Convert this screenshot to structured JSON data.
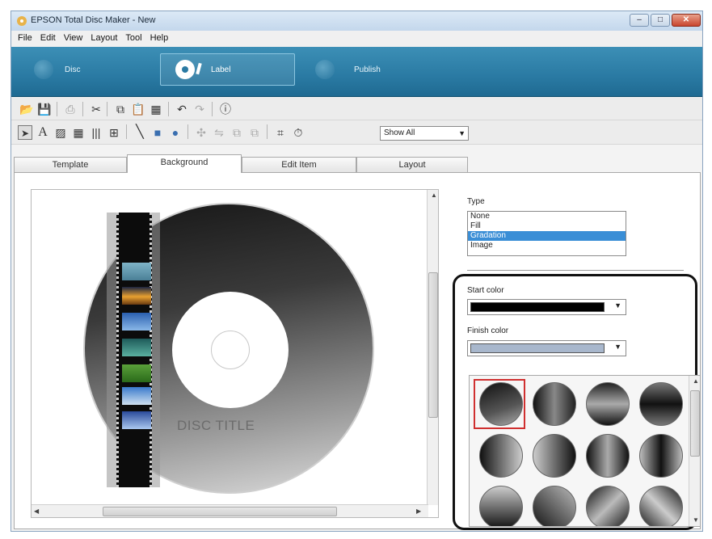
{
  "window": {
    "title": "EPSON Total Disc Maker - New"
  },
  "menu": [
    "File",
    "Edit",
    "View",
    "Layout",
    "Tool",
    "Help"
  ],
  "modes": {
    "disc": "Disc",
    "label": "Label",
    "publish": "Publish"
  },
  "toolbar": {
    "filter_value": "Show All"
  },
  "tabs": [
    "Template",
    "Background",
    "Edit Item",
    "Layout"
  ],
  "active_tab": "Background",
  "canvas": {
    "disc_title": "DISC TITLE"
  },
  "properties": {
    "type_label": "Type",
    "type_options": [
      "None",
      "Fill",
      "Gradation",
      "Image"
    ],
    "type_selected": "Gradation",
    "start_color_label": "Start color",
    "start_color": "#000000",
    "finish_color_label": "Finish color",
    "finish_color": "#a8b7cc",
    "gradation_selected_index": 0
  },
  "colors": {
    "mode_bar": "#2a7aa3",
    "selection": "#3a8ed6",
    "selected_outline": "#d03030"
  }
}
